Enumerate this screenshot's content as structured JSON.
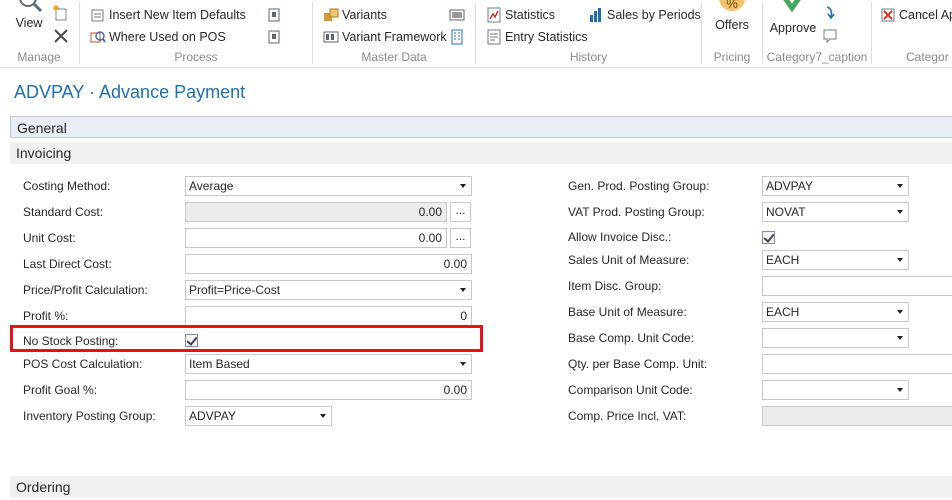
{
  "ribbon": {
    "manage": {
      "caption": "Manage",
      "view_label": "View"
    },
    "process": {
      "caption": "Process",
      "insert_defaults": "Insert New Item Defaults",
      "where_used_pos": "Where Used on POS"
    },
    "master_data": {
      "caption": "Master Data",
      "variants": "Variants",
      "variant_framework": "Variant Framework"
    },
    "history": {
      "caption": "History",
      "statistics": "Statistics",
      "entry_statistics": "Entry Statistics",
      "sales_by_periods": "Sales by Periods"
    },
    "pricing": {
      "caption": "Pricing",
      "offers": "Offers"
    },
    "category7": {
      "caption": "Category7_caption",
      "approve": "Approve"
    },
    "category_last": {
      "caption": "Categor",
      "cancel": "Cancel Ap"
    }
  },
  "page": {
    "title": "ADVPAY · Advance Payment",
    "tabs": {
      "general": "General",
      "invoicing": "Invoicing",
      "ordering": "Ordering"
    }
  },
  "left_fields": {
    "costing_method": {
      "label": "Costing Method:",
      "value": "Average"
    },
    "standard_cost": {
      "label": "Standard Cost:",
      "value": "0.00"
    },
    "unit_cost": {
      "label": "Unit Cost:",
      "value": "0.00"
    },
    "last_direct_cost": {
      "label": "Last Direct Cost:",
      "value": "0.00"
    },
    "price_profit_calc": {
      "label": "Price/Profit Calculation:",
      "value": "Profit=Price-Cost"
    },
    "profit_pct": {
      "label": "Profit %:",
      "value": "0"
    },
    "no_stock_posting": {
      "label": "No Stock Posting:",
      "checked": true
    },
    "pos_cost_calc": {
      "label": "POS Cost Calculation:",
      "value": "Item Based"
    },
    "profit_goal_pct": {
      "label": "Profit Goal %:",
      "value": "0.00"
    },
    "inventory_posting_group": {
      "label": "Inventory Posting Group:",
      "value": "ADVPAY"
    }
  },
  "right_fields": {
    "gen_prod_posting_group": {
      "label": "Gen. Prod. Posting Group:",
      "value": "ADVPAY"
    },
    "vat_prod_posting_group": {
      "label": "VAT Prod. Posting Group:",
      "value": "NOVAT"
    },
    "allow_invoice_disc": {
      "label": "Allow Invoice Disc.:",
      "checked": true
    },
    "sales_unit_of_measure": {
      "label": "Sales Unit of Measure:",
      "value": "EACH"
    },
    "item_disc_group": {
      "label": "Item Disc. Group:",
      "value": ""
    },
    "base_unit_of_measure": {
      "label": "Base Unit of Measure:",
      "value": "EACH"
    },
    "base_comp_unit_code": {
      "label": "Base Comp. Unit Code:",
      "value": ""
    },
    "qty_per_base_comp_unit": {
      "label": "Qty. per Base Comp. Unit:",
      "value": ""
    },
    "comparison_unit_code": {
      "label": "Comparison Unit Code:",
      "value": ""
    },
    "comp_price_incl_vat": {
      "label": "Comp. Price Incl. VAT:",
      "value": ""
    }
  },
  "assist_label": "...",
  "colors": {
    "title_blue": "#1f6fb2",
    "highlight_red": "#e3131b",
    "check_green": "#4aa564"
  }
}
